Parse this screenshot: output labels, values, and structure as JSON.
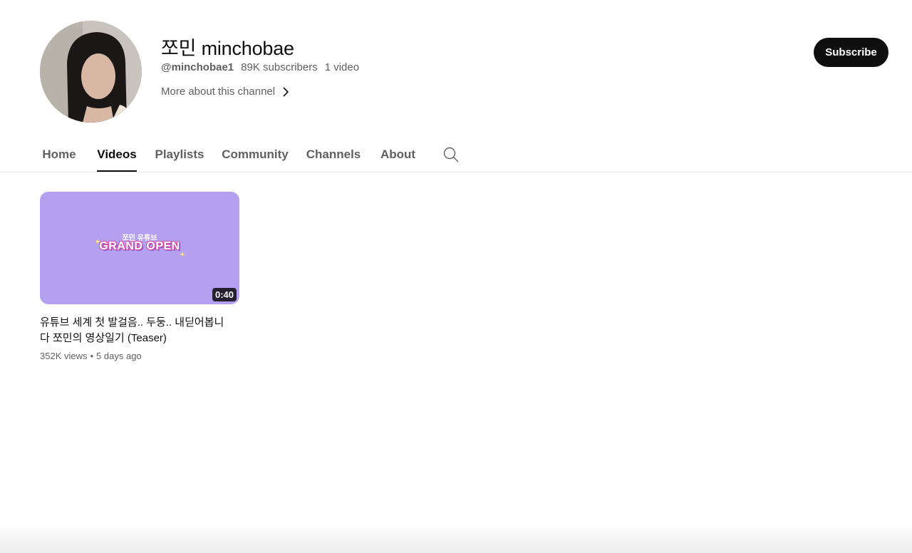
{
  "channel": {
    "name": "쪼민 minchobae",
    "handle": "@minchobae1",
    "subscribers": "89K subscribers",
    "video_count": "1 video",
    "more_label": "More about this channel",
    "subscribe_label": "Subscribe"
  },
  "tabs": [
    {
      "label": "Home",
      "active": false
    },
    {
      "label": "Videos",
      "active": true
    },
    {
      "label": "Playlists",
      "active": false
    },
    {
      "label": "Community",
      "active": false
    },
    {
      "label": "Channels",
      "active": false
    },
    {
      "label": "About",
      "active": false
    }
  ],
  "videos": [
    {
      "thumbnail_top_text": "쪼민 유튜브",
      "thumbnail_main_text": "GRAND OPEN",
      "thumbnail_color": "#b4a0ee",
      "duration": "0:40",
      "title": "유튜브 세계 첫 발걸음.. 두둥.. 내딛어봅니다 쪼민의 영상일기 (Teaser)",
      "views": "352K views",
      "age": "5 days ago"
    }
  ],
  "icons": {
    "search": "search-icon",
    "chevron": "chevron-right-icon"
  }
}
